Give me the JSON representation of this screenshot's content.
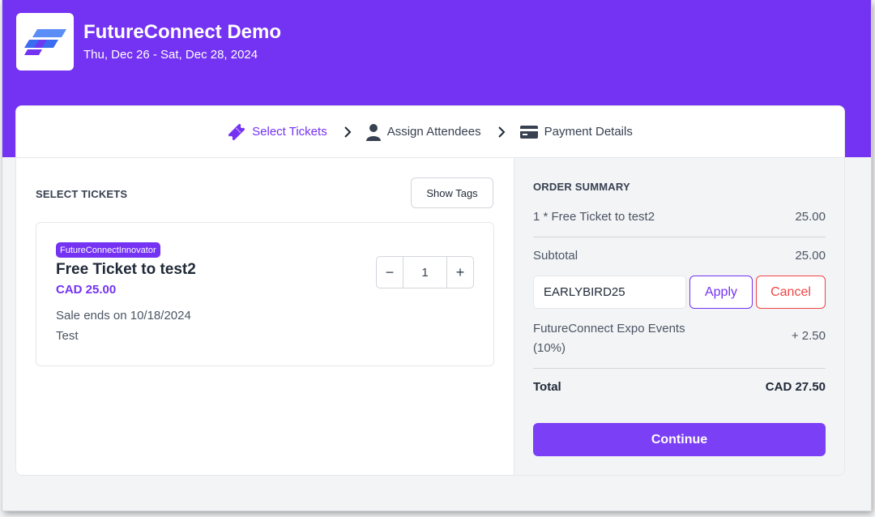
{
  "event": {
    "title": "FutureConnect Demo",
    "dates": "Thu, Dec 26 - Sat, Dec 28, 2024",
    "logo_icon": "futureconnect-logo"
  },
  "steps": [
    {
      "label": "Select Tickets",
      "icon": "ticket-icon",
      "active": true
    },
    {
      "label": "Assign Attendees",
      "icon": "user-icon",
      "active": false
    },
    {
      "label": "Payment Details",
      "icon": "credit-card-icon",
      "active": false
    }
  ],
  "select_tickets": {
    "heading": "SELECT TICKETS",
    "show_tags_label": "Show Tags",
    "ticket": {
      "tag": "FutureConnectInnovator",
      "name": "Free Ticket to test2",
      "price": "CAD 25.00",
      "sale_ends": "Sale ends on 10/18/2024",
      "description": "Test",
      "quantity": "1",
      "decrement": "−",
      "increment": "+"
    }
  },
  "order_summary": {
    "heading": "ORDER SUMMARY",
    "line_item": {
      "label": "1 * Free Ticket to test2",
      "amount": "25.00"
    },
    "subtotal": {
      "label": "Subtotal",
      "amount": "25.00"
    },
    "promo": {
      "value": "EARLYBIRD25",
      "apply_label": "Apply",
      "cancel_label": "Cancel"
    },
    "fee": {
      "label": "FutureConnect Expo Events (10%)",
      "amount": "+ 2.50"
    },
    "total": {
      "label": "Total",
      "amount": "CAD 27.50"
    },
    "continue_label": "Continue"
  },
  "colors": {
    "brand": "#7432f3",
    "danger": "#ef4444",
    "background": "#f3f4f6"
  }
}
